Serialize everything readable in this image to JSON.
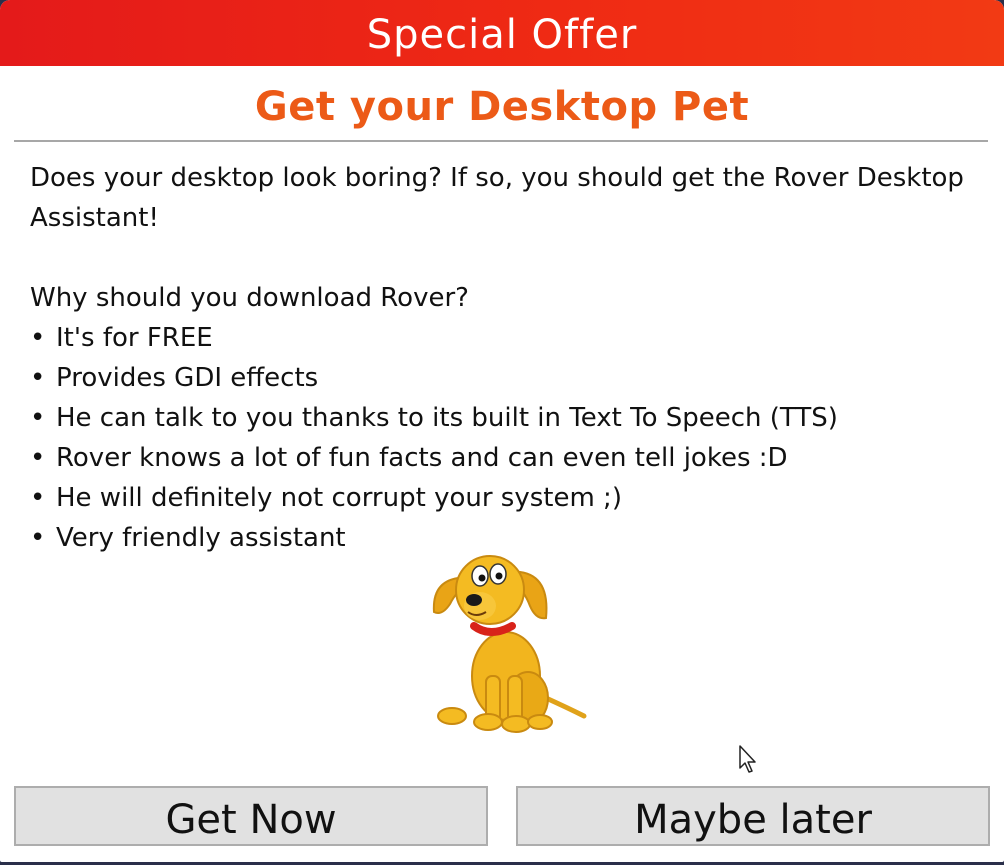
{
  "window": {
    "title": "Special Offer"
  },
  "header": {
    "heading": "Get your Desktop Pet"
  },
  "body": {
    "intro": "Does your desktop look boring? If so, you should get the Rover Desktop Assistant!",
    "question": "Why should you download Rover?",
    "bullet_symbol": "•",
    "features": [
      "It's for FREE",
      "Provides GDI effects",
      "He can talk to you thanks to its built in Text To Speech (TTS)",
      "Rover knows a lot of fun facts and can even tell jokes :D",
      "He will definitely not corrupt your system ;)",
      "Very friendly assistant"
    ]
  },
  "mascot": {
    "icon": "rover-dog-icon"
  },
  "buttons": {
    "get_now": "Get Now",
    "maybe_later": "Maybe later"
  },
  "colors": {
    "titlebar": "#e82014",
    "heading": "#ec5a17",
    "button_bg": "#e1e1e1"
  }
}
